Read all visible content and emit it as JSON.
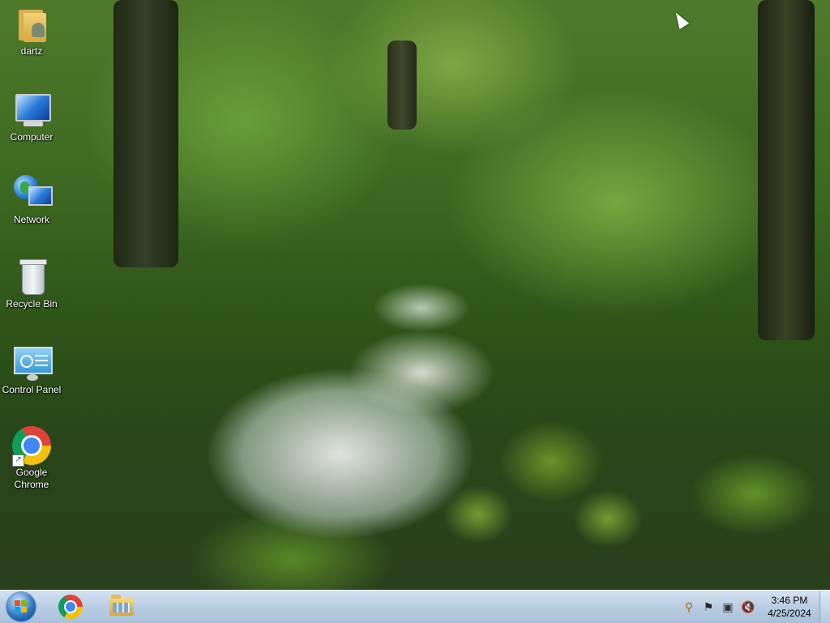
{
  "desktop": {
    "icons": [
      {
        "label": "dartz",
        "icon": "user-folder-icon"
      },
      {
        "label": "Computer",
        "icon": "computer-icon"
      },
      {
        "label": "Network",
        "icon": "network-icon"
      },
      {
        "label": "Recycle Bin",
        "icon": "recycle-bin-icon"
      },
      {
        "label": "Control Panel",
        "icon": "control-panel-icon"
      },
      {
        "label_line1": "Google",
        "label_line2": "Chrome",
        "icon": "chrome-icon"
      }
    ]
  },
  "taskbar": {
    "start": {
      "icon": "windows-start-orb-icon"
    },
    "pinned": [
      {
        "icon": "chrome-icon"
      },
      {
        "icon": "file-explorer-icon"
      }
    ],
    "tray": [
      {
        "icon": "search-icon",
        "glyph": "⚲"
      },
      {
        "icon": "action-center-flag-icon",
        "glyph": "⚑"
      },
      {
        "icon": "network-monitor-icon",
        "glyph": "▣"
      },
      {
        "icon": "volume-muted-icon",
        "glyph": "🔇"
      }
    ],
    "clock": {
      "time": "3:46 PM",
      "date": "4/25/2024"
    }
  },
  "colors": {
    "taskbar": "#b9cde2",
    "label_text": "#ffffff"
  }
}
